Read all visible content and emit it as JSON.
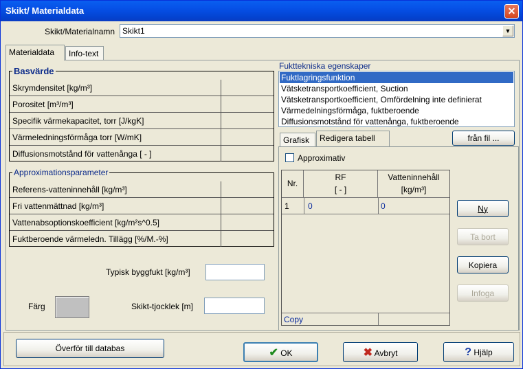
{
  "window": {
    "title": "Skikt/ Materialdata",
    "close_symbol": "✕"
  },
  "material_name": {
    "label": "Skikt/Materialnamn",
    "value": "Skikt1"
  },
  "main_tabs": [
    {
      "label": "Materialdata"
    },
    {
      "label": "Info-text"
    }
  ],
  "basvarde": {
    "title": "Basvärde",
    "rows": [
      {
        "label": "Skrymdensitet [kg/m³]",
        "value": ""
      },
      {
        "label": "Porositet [m³/m³]",
        "value": ""
      },
      {
        "label": "Specifik värmekapacitet, torr [J/kgK]",
        "value": ""
      },
      {
        "label": "Värmeledningsförmåga torr [W/mK]",
        "value": ""
      },
      {
        "label": "Diffusionsmotstånd för vattenånga [ - ]",
        "value": ""
      }
    ]
  },
  "approx": {
    "title": "Approximationsparameter",
    "rows": [
      {
        "label": "Referens-vatteninnehåll [kg/m³]",
        "value": ""
      },
      {
        "label": "Fri vattenmättnad [kg/m³]",
        "value": ""
      },
      {
        "label": "Vattenabsoptionskoefficient [kg/m²s^0.5]",
        "value": ""
      },
      {
        "label": "Fuktberoende värmeledn. Tillägg [%/M.-%]",
        "value": ""
      }
    ]
  },
  "typisk_byggfukt": {
    "label": "Typisk byggfukt [kg/m³]",
    "value": ""
  },
  "farg": {
    "label": "Färg",
    "color": "#C0C0C0"
  },
  "skikt_tjocklek": {
    "label": "Skikt-tjocklek [m]",
    "value": ""
  },
  "fukt": {
    "title": "Fukttekniska egenskaper",
    "items": [
      "Fuktlagringsfunktion",
      "Vätsketransportkoefficient, Suction",
      "Vätsketransportkoefficient, Omfördelning inte definierat",
      "Värmedelningsförmåga, fuktberoende",
      "Diffusionsmotstånd för vattenånga, fuktberoende"
    ],
    "selected_index": 0
  },
  "sub_tabs": [
    {
      "label": "Grafisk"
    },
    {
      "label": "Redigera tabell"
    }
  ],
  "fran_fil": "från fil ...",
  "approximativ": {
    "label": "Approximativ",
    "checked": false
  },
  "table": {
    "headers": {
      "nr": "Nr.",
      "rf": "RF",
      "rf_unit": "[ - ]",
      "vatten": "Vatteninnehåll",
      "vatten_unit": "[kg/m³]"
    },
    "rows": [
      {
        "nr": "1",
        "rf": "0",
        "vatten": "0"
      }
    ],
    "footer": "Copy"
  },
  "side_buttons": {
    "ny": "Ny",
    "ta_bort": "Ta bort",
    "kopiera": "Kopiera",
    "infoga": "Infoga"
  },
  "bottom": {
    "overfor": "Överför till databas",
    "ok": "OK",
    "avbryt": "Avbryt",
    "hjalp": "Hjälp"
  }
}
